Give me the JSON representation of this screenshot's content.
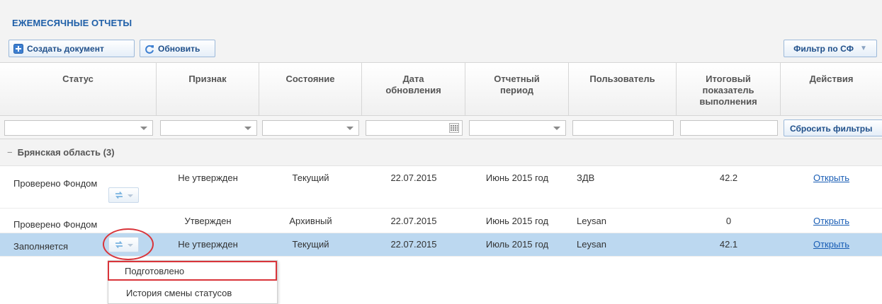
{
  "panel": {
    "title": "ЕЖЕМЕСЯЧНЫЕ ОТЧЕТЫ"
  },
  "toolbar": {
    "create_label": "Создать документ",
    "create_icon": "plus-icon",
    "refresh_label": "Обновить",
    "refresh_icon": "refresh-icon",
    "filter_label": "Фильтр по СФ",
    "filter_icon": "caret-down-icon"
  },
  "columns": [
    {
      "key": "status",
      "label": "Статус"
    },
    {
      "key": "sign",
      "label": "Признак"
    },
    {
      "key": "state",
      "label": "Состояние"
    },
    {
      "key": "updated",
      "label": "Дата обновления"
    },
    {
      "key": "period",
      "label": "Отчетный период"
    },
    {
      "key": "user",
      "label": "Пользователь"
    },
    {
      "key": "total",
      "label": "Итоговый показатель выполнения"
    },
    {
      "key": "actions",
      "label": "Действия"
    }
  ],
  "filters": {
    "reset_label": "Сбросить фильтры"
  },
  "group": {
    "toggle": "−",
    "label": "Брянская область (3)"
  },
  "rows": [
    {
      "status": "Проверено Фондом",
      "sign": "Не утвержден",
      "state": "Текущий",
      "updated": "22.07.2015",
      "period": "Июнь 2015 год",
      "user": "ЗДВ",
      "total": "42.2",
      "action": "Открыть",
      "selected": false
    },
    {
      "status": "Проверено Фондом",
      "sign": "Утвержден",
      "state": "Архивный",
      "updated": "22.07.2015",
      "period": "Июнь 2015 год",
      "user": "Leysan",
      "total": "0",
      "action": "Открыть",
      "selected": false
    },
    {
      "status": "Заполняется",
      "sign": "Не утвержден",
      "state": "Текущий",
      "updated": "22.07.2015",
      "period": "Июль 2015 год",
      "user": "Leysan",
      "total": "42.1",
      "action": "Открыть",
      "selected": true
    }
  ],
  "status_menu": {
    "items": [
      "Подготовлено",
      "История смены статусов"
    ],
    "highlighted_index": 0
  },
  "colors": {
    "title": "#1f5fa8",
    "selected_row": "#bcd8f0",
    "link": "#1a5eb5",
    "annotation": "#d9343a"
  }
}
